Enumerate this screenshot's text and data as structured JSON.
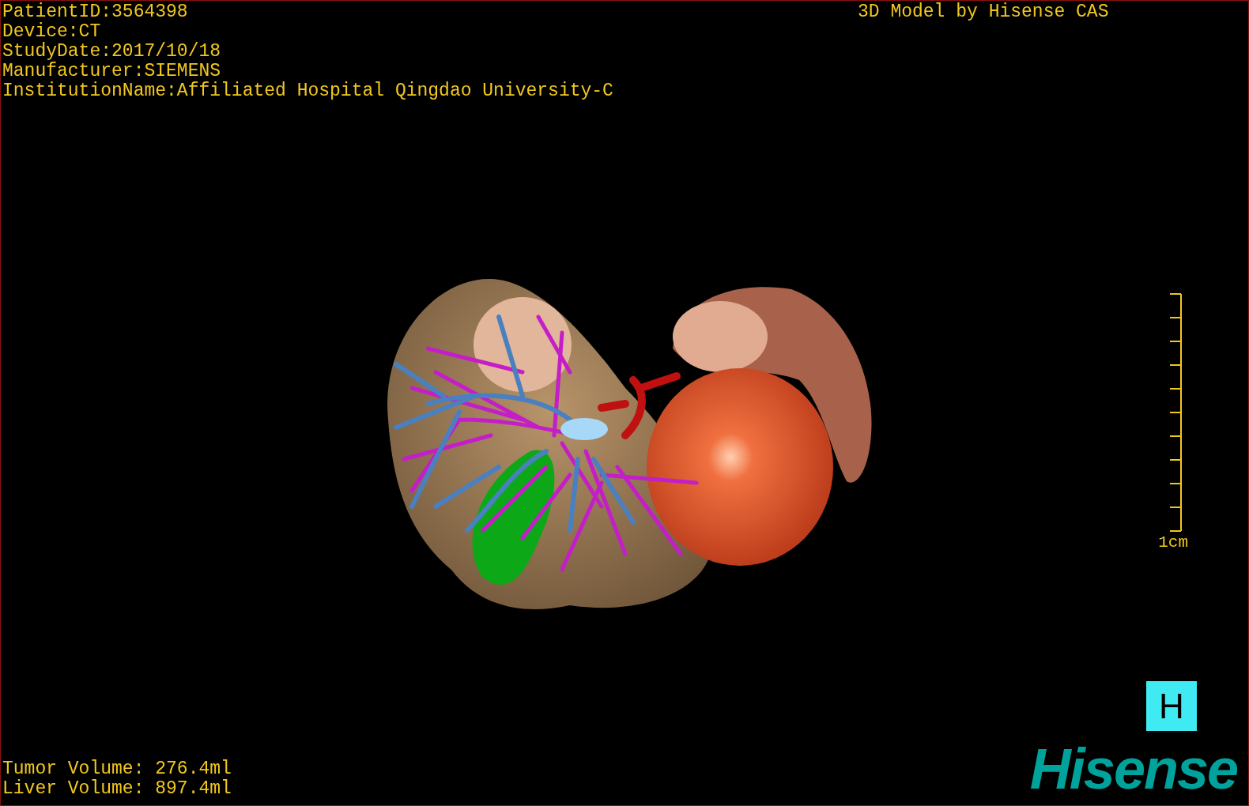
{
  "viewport": {
    "patient_info": [
      "PatientID:3564398",
      "Device:CT",
      "StudyDate:2017/10/18",
      "Manufacturer:SIEMENS",
      "InstitutionName:Affiliated Hospital Qingdao University-C"
    ],
    "title": "3D Model by Hisense CAS",
    "scale_bar": {
      "label": "1cm"
    },
    "orientation_marker": "H",
    "volumes": [
      "Tumor Volume: 276.4ml",
      "Liver Volume: 897.4ml"
    ],
    "logo": "Hisense"
  }
}
